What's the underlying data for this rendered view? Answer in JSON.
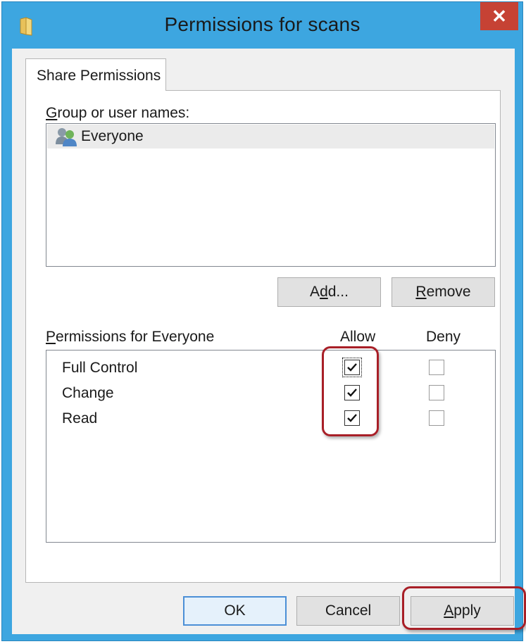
{
  "window": {
    "title": "Permissions for scans",
    "close_label": "✕"
  },
  "tab": {
    "label": "Share Permissions"
  },
  "group": {
    "label_prefix": "G",
    "label_rest": "roup or user names:",
    "items": [
      {
        "name": "Everyone",
        "icon": "users-icon",
        "selected": true
      }
    ]
  },
  "buttons": {
    "add_prefix": "A",
    "add_accel": "d",
    "add_rest": "d...",
    "remove_accel": "R",
    "remove_rest": "emove",
    "ok": "OK",
    "cancel": "Cancel",
    "apply_accel": "A",
    "apply_rest": "pply"
  },
  "permissions": {
    "label_accel": "P",
    "label_rest": "ermissions for Everyone",
    "allow_header": "Allow",
    "deny_header": "Deny",
    "rows": [
      {
        "name": "Full Control",
        "allow": true,
        "deny": false
      },
      {
        "name": "Change",
        "allow": true,
        "deny": false
      },
      {
        "name": "Read",
        "allow": true,
        "deny": false
      }
    ]
  },
  "colors": {
    "titlebar": "#3da6e0",
    "close": "#c64234",
    "highlight": "#a81f27"
  }
}
